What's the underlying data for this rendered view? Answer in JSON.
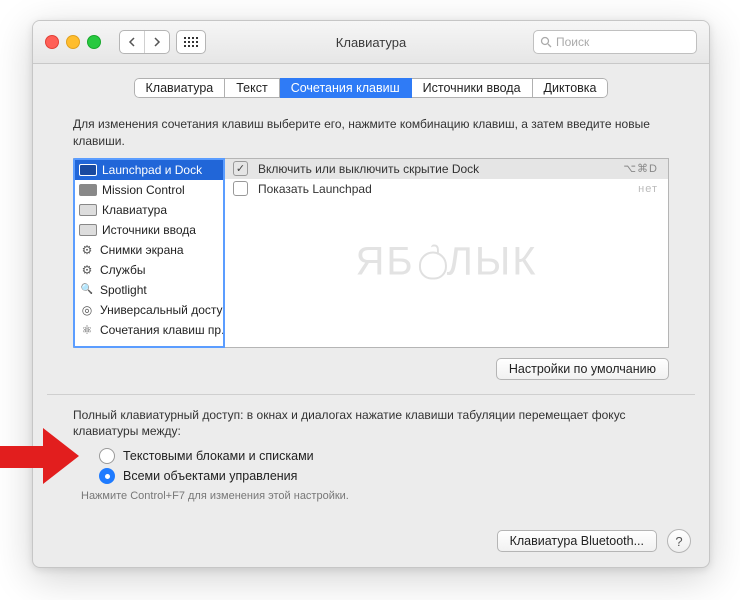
{
  "window": {
    "title": "Клавиатура"
  },
  "search": {
    "placeholder": "Поиск"
  },
  "tabs": [
    {
      "label": "Клавиатура",
      "selected": false
    },
    {
      "label": "Текст",
      "selected": false
    },
    {
      "label": "Сочетания клавиш",
      "selected": true
    },
    {
      "label": "Источники ввода",
      "selected": false
    },
    {
      "label": "Диктовка",
      "selected": false
    }
  ],
  "description": "Для изменения сочетания клавиш выберите его, нажмите комбинацию клавиш, а затем введите новые клавиши.",
  "categories": [
    {
      "label": "Launchpad и Dock",
      "icon": "display",
      "selected": true
    },
    {
      "label": "Mission Control",
      "icon": "display",
      "selected": false
    },
    {
      "label": "Клавиатура",
      "icon": "keyboard",
      "selected": false
    },
    {
      "label": "Источники ввода",
      "icon": "keyboard",
      "selected": false
    },
    {
      "label": "Снимки экрана",
      "icon": "gear",
      "selected": false
    },
    {
      "label": "Службы",
      "icon": "gear",
      "selected": false
    },
    {
      "label": "Spotlight",
      "icon": "spot",
      "selected": false
    },
    {
      "label": "Универсальный доступ",
      "icon": "access",
      "selected": false
    },
    {
      "label": "Сочетания клавиш пр...",
      "icon": "atom",
      "selected": false
    }
  ],
  "shortcuts": [
    {
      "enabled": true,
      "label": "Включить или выключить скрытие Dock",
      "keys": "⌥⌘D",
      "selected": true
    },
    {
      "enabled": false,
      "label": "Показать Launchpad",
      "keys": "нет",
      "selected": false
    }
  ],
  "defaults_btn": "Настройки по умолчанию",
  "fka_desc": "Полный клавиатурный доступ: в окнах и диалогах нажатие клавиши табуляции перемещает фокус клавиатуры между:",
  "fka": {
    "opt1": "Текстовыми блоками и списками",
    "opt2": "Всеми объектами управления",
    "selected": 2
  },
  "fka_hint": "Нажмите Control+F7 для изменения этой настройки.",
  "footer": {
    "bluetooth_btn": "Клавиатура Bluetooth...",
    "help": "?"
  },
  "watermark": {
    "a": "ЯБ",
    "b": "ЛЫК"
  }
}
